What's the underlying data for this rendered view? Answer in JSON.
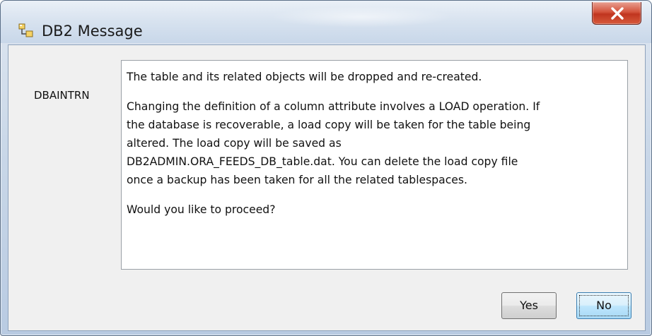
{
  "window": {
    "title": "DB2 Message",
    "icon": "db2-app-icon",
    "close_icon": "close-icon"
  },
  "dialog": {
    "object_name": "DBAINTRN",
    "message_lines": [
      "The table and its related objects will be dropped and re-created.",
      "",
      "Changing the definition of a column attribute involves a LOAD operation. If",
      "the database is recoverable, a load copy will be taken for the table being",
      "altered. The load copy will be saved as",
      "DB2ADMIN.ORA_FEEDS_DB_table.dat. You can delete the load copy file",
      "once a backup has been taken for all the related tablespaces.",
      "",
      "Would you like to proceed?"
    ]
  },
  "buttons": {
    "yes_label": "Yes",
    "no_label": "No"
  },
  "colors": {
    "close_button": "#c0351f",
    "default_button_border": "#3c7fb1"
  }
}
